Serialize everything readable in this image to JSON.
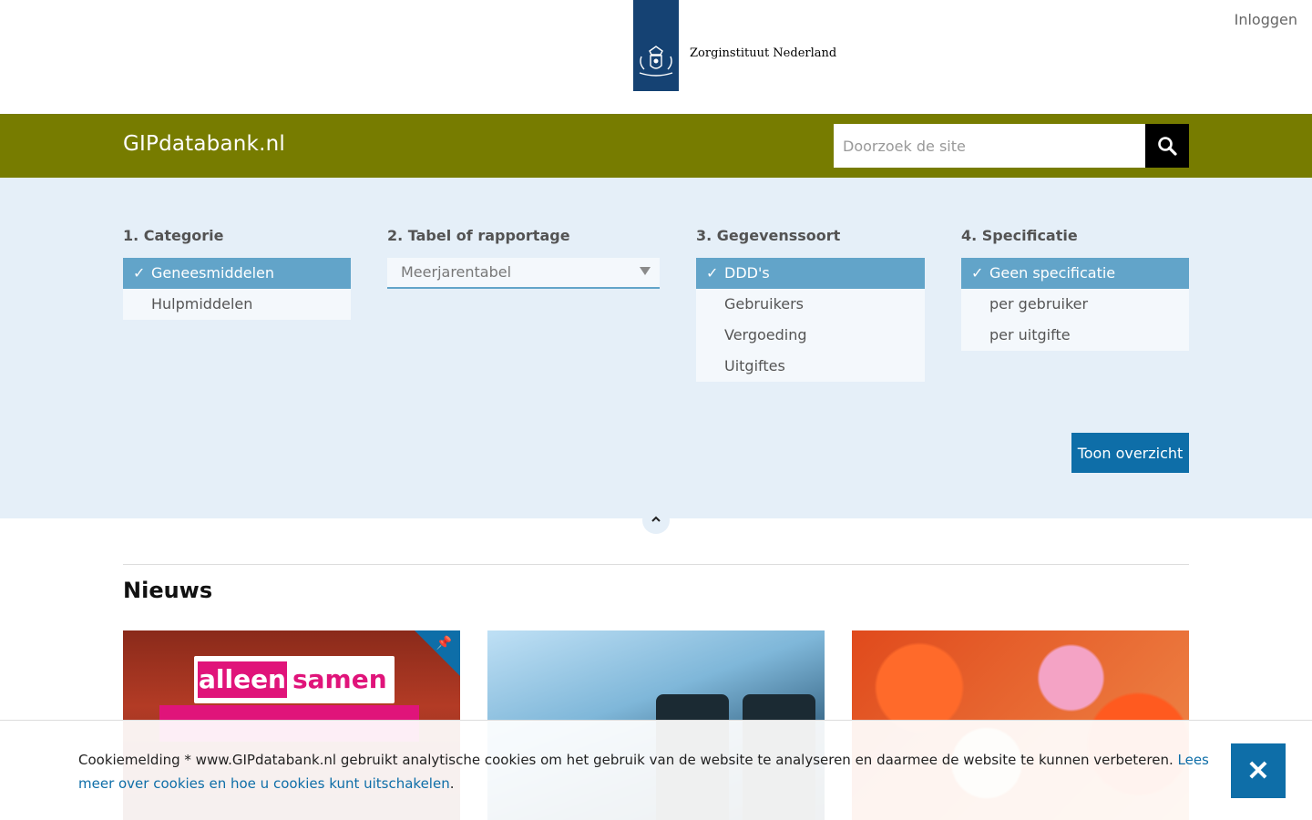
{
  "header": {
    "organization": "Zorginstituut Nederland",
    "login": "Inloggen",
    "logo_icon": "coat-of-arms-icon",
    "logo_color": "#154273"
  },
  "brandbar": {
    "site_title": "GIPdatabank.nl",
    "search_placeholder": "Doorzoek de site",
    "search_icon": "search-icon",
    "color": "#777c00"
  },
  "filters": {
    "category": {
      "title": "1. Categorie",
      "options": [
        {
          "label": "Geneesmiddelen",
          "selected": true
        },
        {
          "label": "Hulpmiddelen",
          "selected": false
        }
      ]
    },
    "table": {
      "title": "2. Tabel of rapportage",
      "selected": "Meerjarentabel"
    },
    "datatype": {
      "title": "3. Gegevenssoort",
      "options": [
        {
          "label": "DDD's",
          "selected": true
        },
        {
          "label": "Gebruikers",
          "selected": false
        },
        {
          "label": "Vergoeding",
          "selected": false
        },
        {
          "label": "Uitgiftes",
          "selected": false
        }
      ]
    },
    "specification": {
      "title": "4. Specificatie",
      "options": [
        {
          "label": "Geen specificatie",
          "selected": true
        },
        {
          "label": "per gebruiker",
          "selected": false
        },
        {
          "label": "per uitgifte",
          "selected": false
        }
      ]
    },
    "show_button": "Toon overzicht",
    "check_mark": "✓"
  },
  "news": {
    "title": "Nieuws",
    "card1_banner_a": "alleen",
    "card1_banner_b": "samen"
  },
  "cookie": {
    "text": "Cookiemelding * www.GIPdatabank.nl gebruikt analytische cookies om het gebruik van de website te analyseren en daarmee de website te kunnen verbeteren. ",
    "link": "Lees meer over cookies en hoe u cookies kunt uitschakelen",
    "suffix": ".",
    "close": "✕"
  }
}
